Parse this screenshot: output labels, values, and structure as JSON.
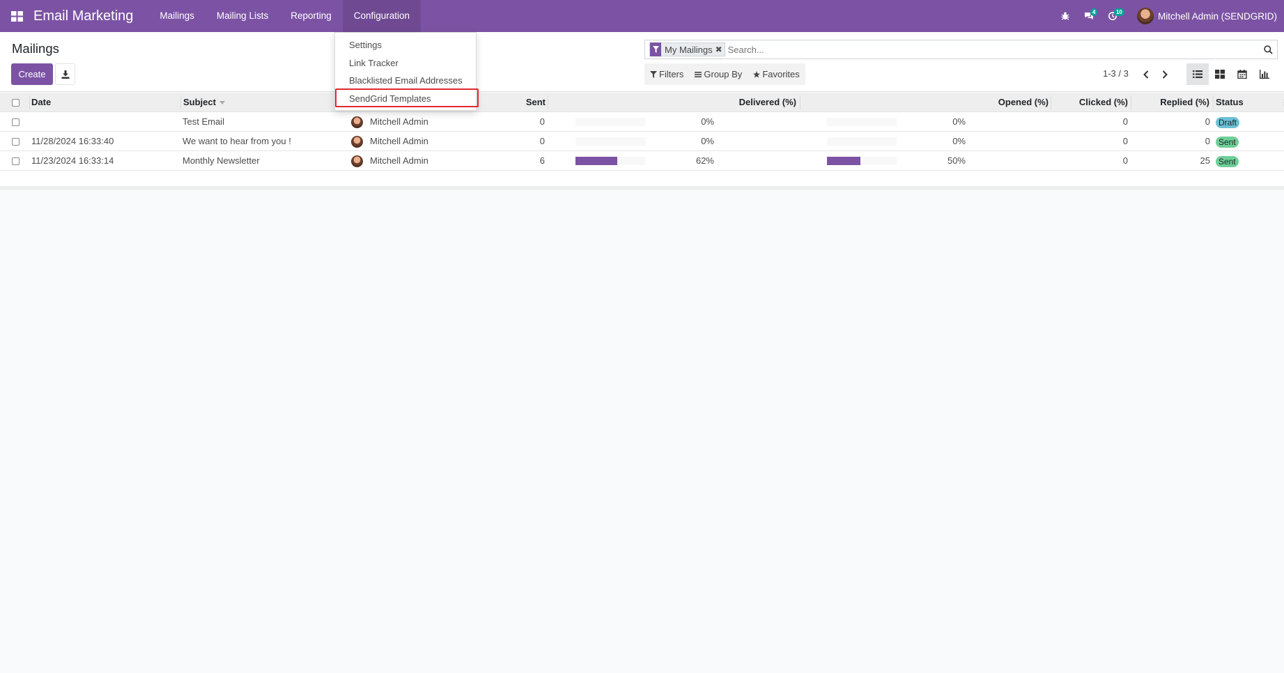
{
  "navbar": {
    "app_title": "Email Marketing",
    "menu": [
      "Mailings",
      "Mailing Lists",
      "Reporting",
      "Configuration"
    ],
    "chat_badge": "4",
    "activity_badge": "10",
    "user_name": "Mitchell Admin (SENDGRID)",
    "accent_color": "#7c53a4"
  },
  "control": {
    "title": "Mailings",
    "create_label": "Create",
    "facet_label": "My Mailings",
    "search_placeholder": "Search...",
    "filters_label": "Filters",
    "group_by_label": "Group By",
    "favorites_label": "Favorites",
    "pager": "1-3 / 3"
  },
  "dropdown": {
    "items": [
      "Settings",
      "Link Tracker",
      "Blacklisted Email Addresses",
      "SendGrid Templates"
    ],
    "highlighted": "SendGrid Templates"
  },
  "table": {
    "headers": {
      "date": "Date",
      "subject": "Subject",
      "sent": "Sent",
      "delivered": "Delivered (%)",
      "opened": "Opened (%)",
      "clicked": "Clicked (%)",
      "replied": "Replied (%)",
      "status": "Status"
    },
    "rows": [
      {
        "date": "",
        "subject": "Test Email",
        "user": "Mitchell Admin",
        "sent": "0",
        "delivered_pct": 0,
        "delivered": "0%",
        "opened_pct": 0,
        "opened": "0%",
        "clicked": "0",
        "replied": "0",
        "status": "Draft"
      },
      {
        "date": "11/28/2024 16:33:40",
        "subject": "We want to hear from you !",
        "user": "Mitchell Admin",
        "sent": "0",
        "delivered_pct": 0,
        "delivered": "0%",
        "opened_pct": 0,
        "opened": "0%",
        "clicked": "0",
        "replied": "0",
        "status": "Sent"
      },
      {
        "date": "11/23/2024 16:33:14",
        "subject": "Monthly Newsletter",
        "user": "Mitchell Admin",
        "sent": "6",
        "delivered_pct": 62,
        "delivered": "62%",
        "opened_pct": 50,
        "opened": "50%",
        "clicked": "0",
        "replied": "25",
        "status": "Sent"
      }
    ]
  }
}
